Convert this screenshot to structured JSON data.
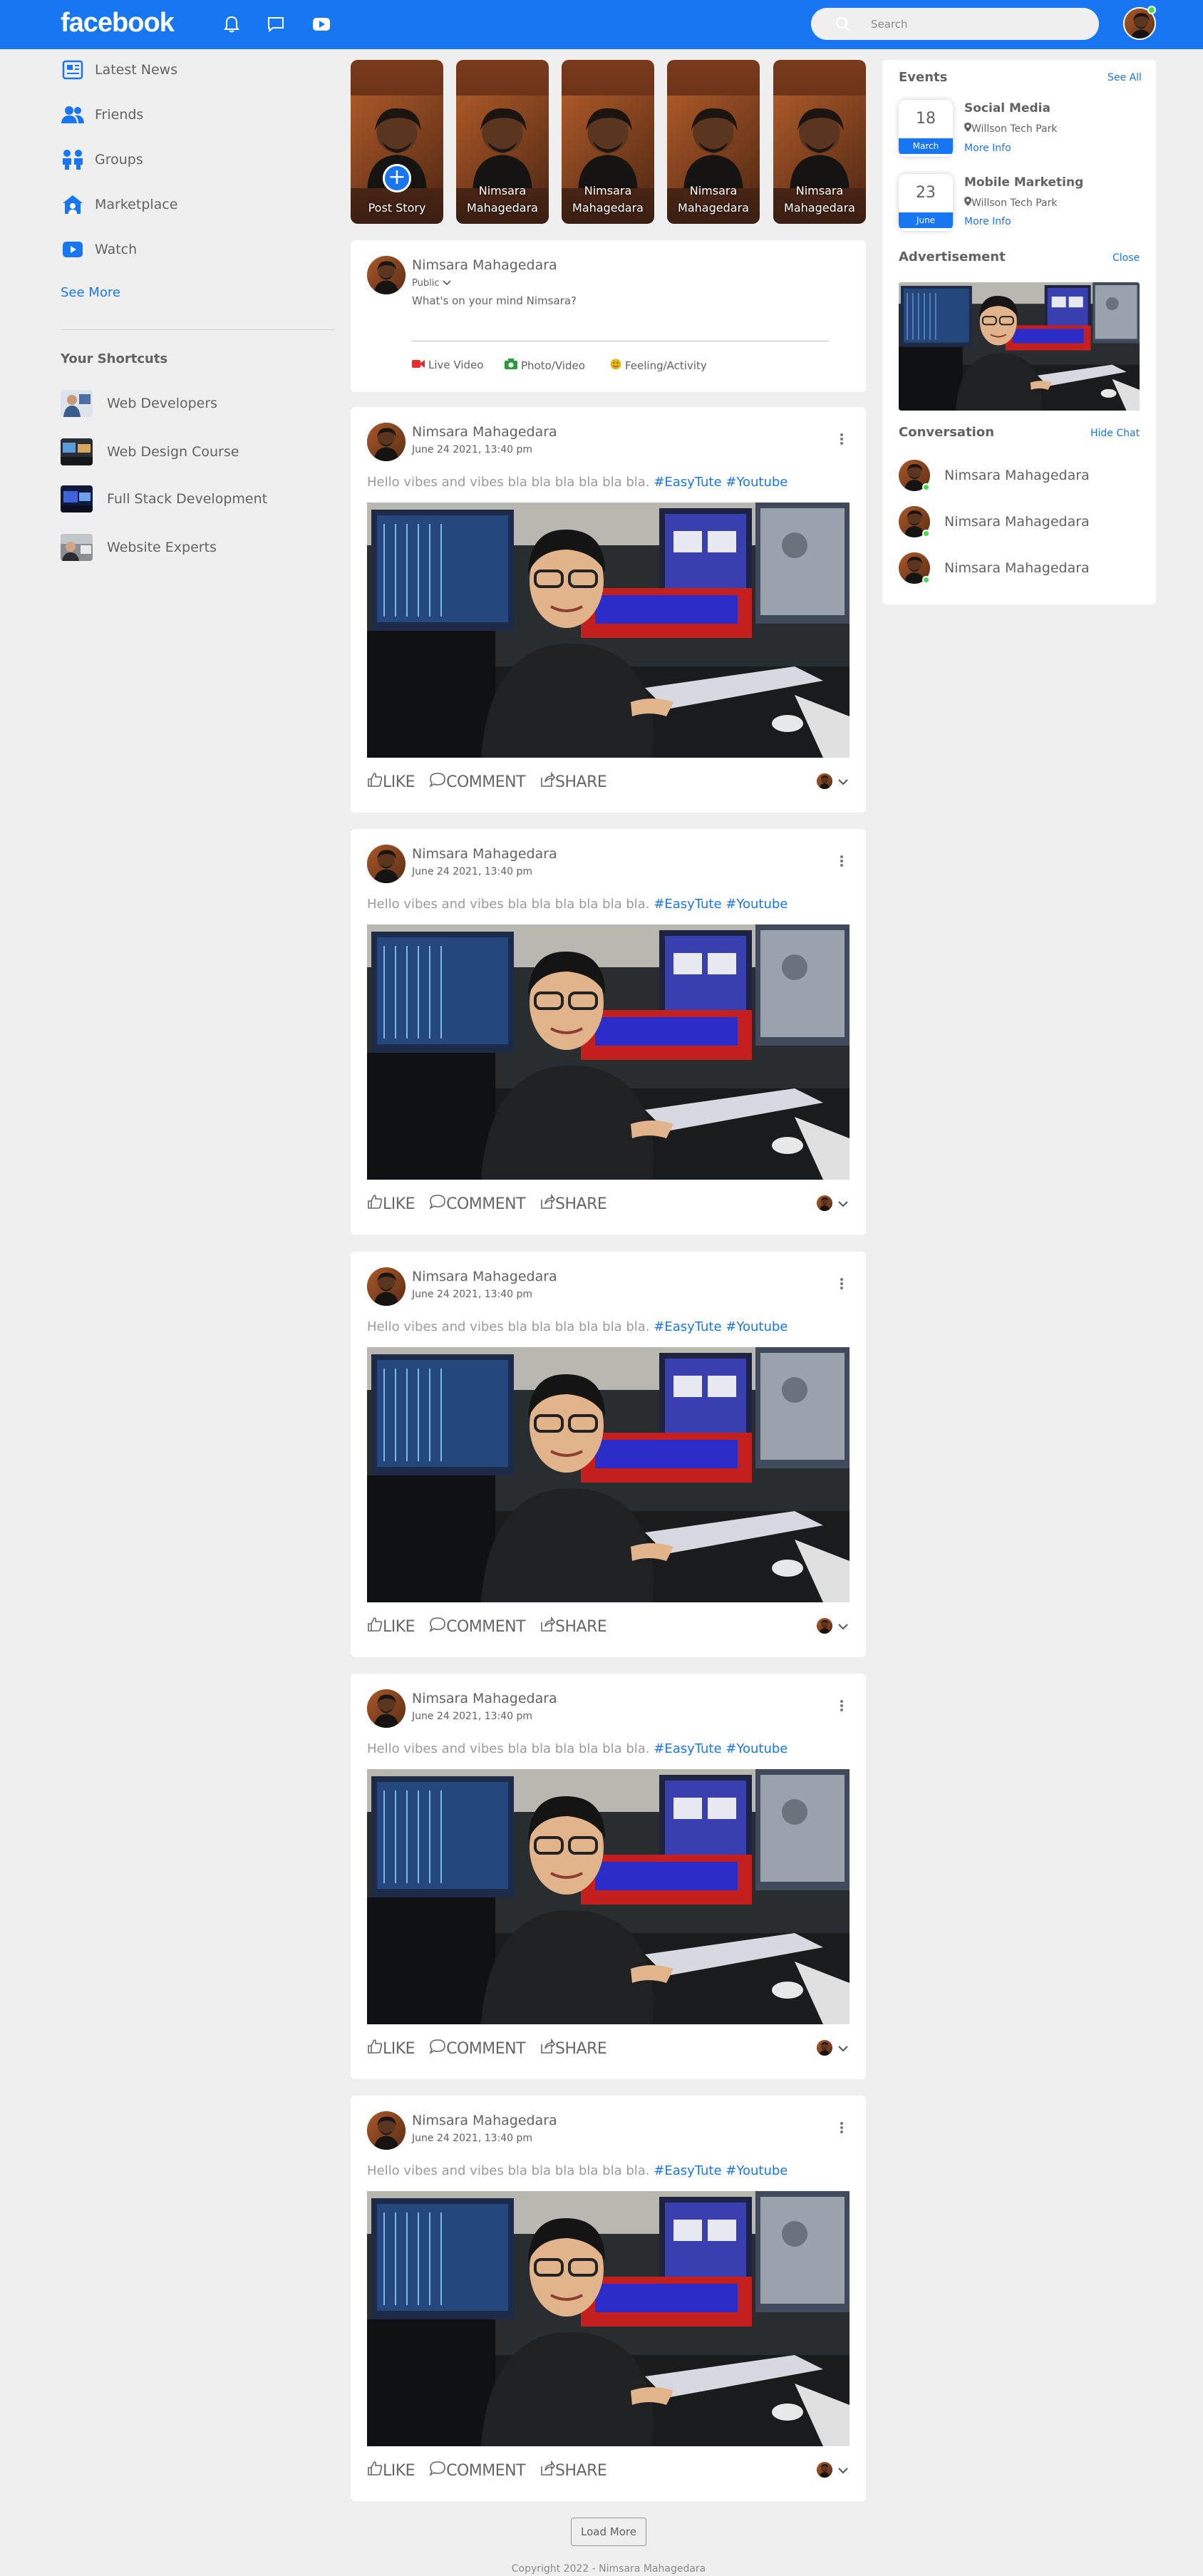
{
  "header": {
    "logo": "facebook",
    "search_placeholder": "Search",
    "icons": [
      "bell-icon",
      "chat-icon",
      "video-icon"
    ]
  },
  "sidebar": {
    "items": [
      {
        "label": "Latest News",
        "icon": "news-icon"
      },
      {
        "label": "Friends",
        "icon": "friends-icon"
      },
      {
        "label": "Groups",
        "icon": "groups-icon"
      },
      {
        "label": "Marketplace",
        "icon": "marketplace-icon"
      },
      {
        "label": "Watch",
        "icon": "watch-icon"
      }
    ],
    "see_more": "See More",
    "shortcuts_title": "Your Shortcuts",
    "shortcuts": [
      {
        "label": "Web Developers"
      },
      {
        "label": "Web Design Course"
      },
      {
        "label": "Full Stack Development"
      },
      {
        "label": "Website Experts"
      }
    ]
  },
  "stories": [
    {
      "label": "Post Story"
    },
    {
      "label": "Nimsara Mahagedara"
    },
    {
      "label": "Nimsara Mahagedara"
    },
    {
      "label": "Nimsara Mahagedara"
    },
    {
      "label": "Nimsara Mahagedara"
    }
  ],
  "composer": {
    "name": "Nimsara Mahagedara",
    "privacy": "Public",
    "placeholder": "What's on your mind Nimsara?",
    "options": [
      "Live Video",
      "Photo/Video",
      "Feeling/Activity"
    ]
  },
  "posts": [
    {
      "name": "Nimsara Mahagedara",
      "date": "June 24 2021, 13:40 pm",
      "text": "Hello vibes and vibes bla bla bla bla bla bla.",
      "tags": "#EasyTute #Youtube"
    },
    {
      "name": "Nimsara Mahagedara",
      "date": "June 24 2021, 13:40 pm",
      "text": "Hello vibes and vibes bla bla bla bla bla bla.",
      "tags": "#EasyTute #Youtube"
    },
    {
      "name": "Nimsara Mahagedara",
      "date": "June 24 2021, 13:40 pm",
      "text": "Hello vibes and vibes bla bla bla bla bla bla.",
      "tags": "#EasyTute #Youtube"
    },
    {
      "name": "Nimsara Mahagedara",
      "date": "June 24 2021, 13:40 pm",
      "text": "Hello vibes and vibes bla bla bla bla bla bla.",
      "tags": "#EasyTute #Youtube"
    },
    {
      "name": "Nimsara Mahagedara",
      "date": "June 24 2021, 13:40 pm",
      "text": "Hello vibes and vibes bla bla bla bla bla bla.",
      "tags": "#EasyTute #Youtube"
    }
  ],
  "post_actions": {
    "like": "LIKE",
    "comment": "COMMENT",
    "share": "SHARE"
  },
  "right": {
    "events_title": "Events",
    "see_all": "See All",
    "events": [
      {
        "day": "18",
        "month": "March",
        "title": "Social Media",
        "location": "Willson Tech Park",
        "more": "More Info"
      },
      {
        "day": "23",
        "month": "June",
        "title": "Mobile Marketing",
        "location": "Willson Tech Park",
        "more": "More Info"
      }
    ],
    "ad_title": "Advertisement",
    "close": "Close",
    "conversation_title": "Conversation",
    "hide_chat": "Hide Chat",
    "conversations": [
      {
        "name": "Nimsara Mahagedara"
      },
      {
        "name": "Nimsara Mahagedara"
      },
      {
        "name": "Nimsara Mahagedara"
      }
    ]
  },
  "load_more": "Load More",
  "footer": "Copyright 2022 - Nimsara Mahagedara",
  "colors": {
    "brand": "#1876f2",
    "background": "#efefef",
    "online": "#41db51"
  }
}
